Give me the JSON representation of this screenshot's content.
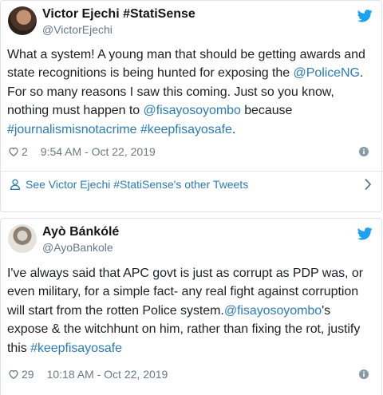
{
  "tweets": [
    {
      "display_name": "Victor Ejechi #StatiSense",
      "handle": "@VictorEjechi",
      "lines": [
        [
          {
            "t": "What a system! A young man that should be getting awards and"
          }
        ],
        [
          {
            "t": "state recognitions is being hunted for exposing the "
          },
          {
            "t": "@PoliceNG",
            "link": true
          },
          {
            "t": "."
          }
        ],
        [
          {
            "t": "For so many reasons I saw this coming. Just so you know,"
          }
        ],
        [
          {
            "t": "nothing must happen to "
          },
          {
            "t": "@fisayosoyombo",
            "link": true
          },
          {
            "t": " because"
          }
        ],
        [
          {
            "t": "#journalismisnotacrime",
            "link": true
          },
          {
            "t": " "
          },
          {
            "t": "#keepfisayosafe",
            "link": true
          },
          {
            "t": "."
          }
        ]
      ],
      "like_count": "2",
      "timestamp": "9:54 AM - Oct 22, 2019",
      "see_more": "See Victor Ejechi #StatiSense's other Tweets"
    },
    {
      "display_name": "Ayò Bánkólé",
      "handle": "@AyoBankole",
      "lines": [
        [
          {
            "t": "I've always said that APC govt is just as corrupt as PDP was, or"
          }
        ],
        [
          {
            "t": "even military, for a simple fact- any real fight against corruption"
          }
        ],
        [
          {
            "t": "will start from the rotten Police system."
          },
          {
            "t": "@fisayosoyombo",
            "link": true
          },
          {
            "t": "'s"
          }
        ],
        [
          {
            "t": "expose & the witchhunt on him, rather than fixing the rot, justify"
          }
        ],
        [
          {
            "t": "this "
          },
          {
            "t": "#keepfisayosafe",
            "link": true
          }
        ]
      ],
      "like_count": "29",
      "timestamp": "10:18 AM - Oct 22, 2019"
    }
  ],
  "colors": {
    "link": "#2b7bb9",
    "twitter_blue": "#1da1f2",
    "meta_gray": "#697882"
  },
  "icons": [
    "twitter-bird-icon",
    "heart-icon",
    "info-icon",
    "user-icon",
    "chevron-right-icon"
  ]
}
